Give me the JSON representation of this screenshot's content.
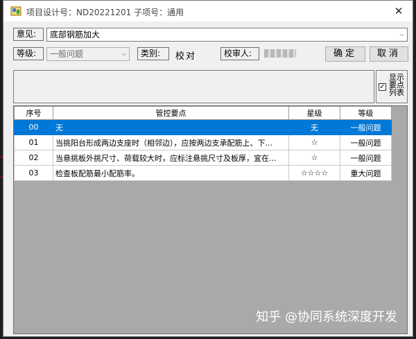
{
  "window": {
    "title": "项目设计号：ND20221201   子项号：通用",
    "close_glyph": "✕"
  },
  "form": {
    "opinion_label": "意见:",
    "opinion_value": "底部钢筋加大",
    "level_label": "等级:",
    "level_value": "一般问题",
    "category_label": "类别:",
    "category_value": "校对",
    "reviewer_label": "校审人:",
    "confirm_label": "确定",
    "cancel_label": "取消",
    "show_points_label": "显示要点列表",
    "show_points_checked": true
  },
  "table": {
    "columns": [
      "序号",
      "管控要点",
      "星级",
      "等级"
    ],
    "rows": [
      {
        "no": "00",
        "point": "无",
        "stars": "无",
        "level": "一般问题",
        "selected": true
      },
      {
        "no": "01",
        "point": "当挑阳台形成两边支座时（相邻边），应按两边支承配筋上、下...",
        "stars": "☆",
        "level": "一般问题",
        "selected": false
      },
      {
        "no": "02",
        "point": "当悬挑板外挑尺寸、荷载较大时，应标注悬挑尺寸及板厚，宜在...",
        "stars": "☆",
        "level": "一般问题",
        "selected": false
      },
      {
        "no": "03",
        "point": "检查板配筋最小配筋率。",
        "stars": "☆☆☆☆",
        "level": "重大问题",
        "selected": false
      }
    ]
  },
  "watermark": "知乎 @协同系统深度开发",
  "colors": {
    "selection": "#0078d7",
    "grid_bg": "#a9a9a9",
    "window_bg": "#f0f0f0"
  },
  "icons": {
    "app": "app-icon",
    "close": "close-icon",
    "dropdown": "chevron-down-icon"
  }
}
